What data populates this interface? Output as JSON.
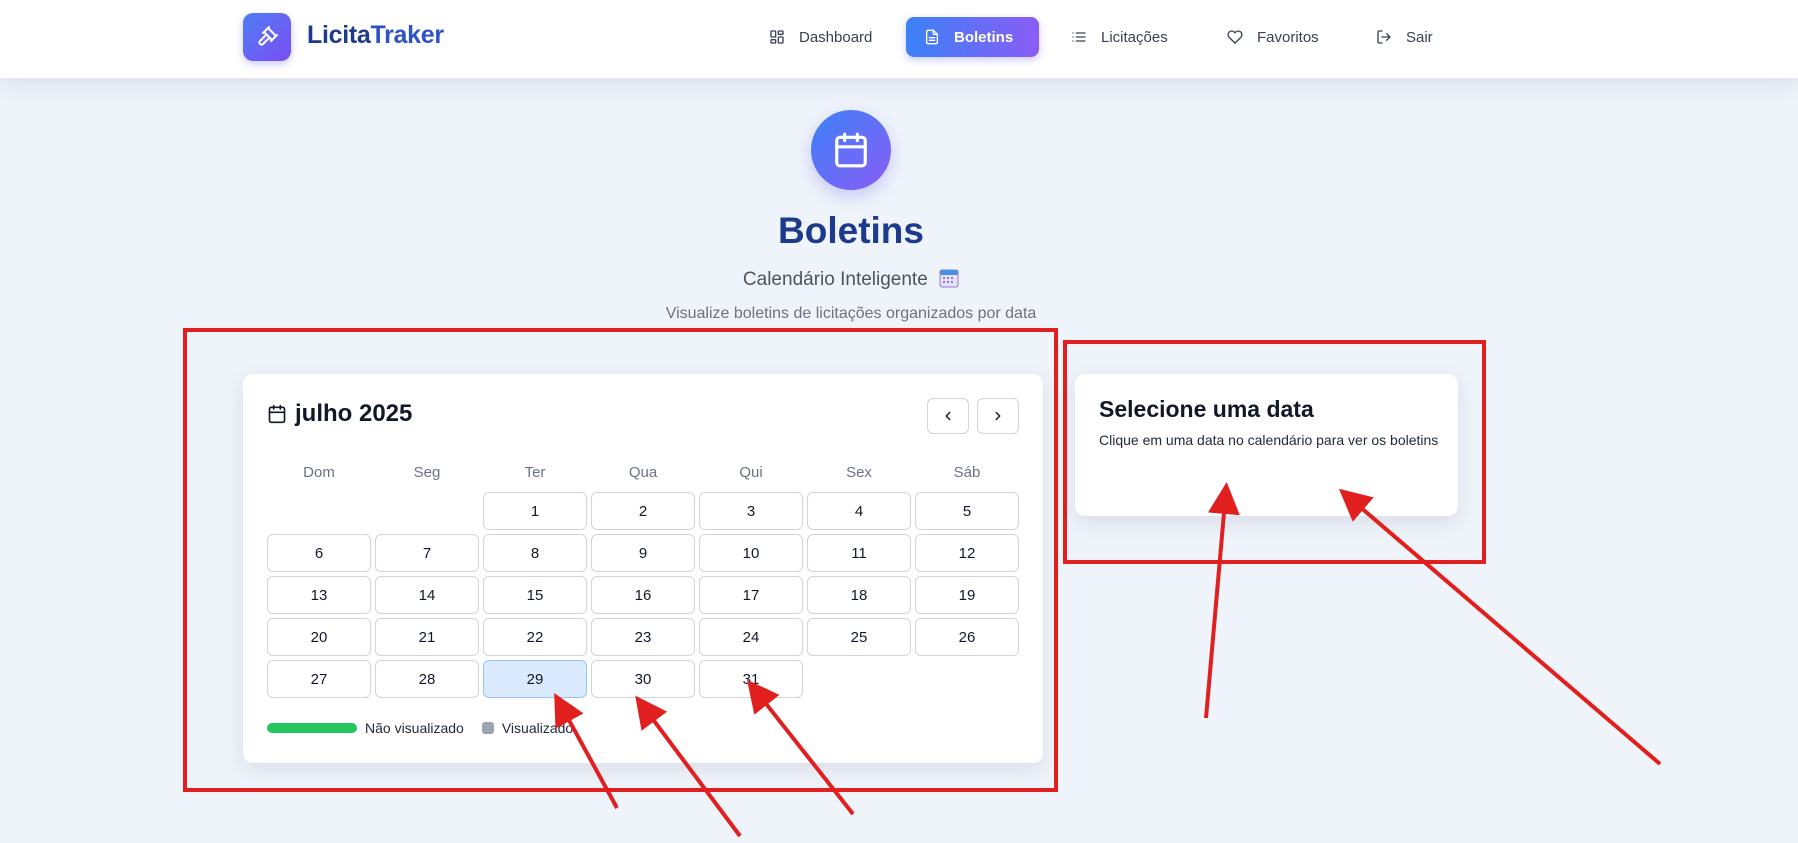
{
  "app": {
    "name_part1": "Licita",
    "name_part2": "Traker"
  },
  "nav": [
    {
      "label": "Dashboard",
      "icon": "dashboard-icon",
      "active": false
    },
    {
      "label": "Boletins",
      "icon": "document-icon",
      "active": true
    },
    {
      "label": "Licitações",
      "icon": "list-icon",
      "active": false
    },
    {
      "label": "Favoritos",
      "icon": "heart-icon",
      "active": false
    },
    {
      "label": "Sair",
      "icon": "logout-icon",
      "active": false
    }
  ],
  "hero": {
    "title": "Boletins",
    "subtitle": "Calendário Inteligente",
    "description": "Visualize boletins de licitações organizados por data"
  },
  "calendar": {
    "month_label": "julho 2025",
    "weekdays": [
      "Dom",
      "Seg",
      "Ter",
      "Qua",
      "Qui",
      "Sex",
      "Sáb"
    ],
    "first_weekday_index": 2,
    "days": [
      "1",
      "2",
      "3",
      "4",
      "5",
      "6",
      "7",
      "8",
      "9",
      "10",
      "11",
      "12",
      "13",
      "14",
      "15",
      "16",
      "17",
      "18",
      "19",
      "20",
      "21",
      "22",
      "23",
      "24",
      "25",
      "26",
      "27",
      "28",
      "29",
      "30",
      "31"
    ],
    "selected_day": "29",
    "legend": {
      "not_viewed": "Não visualizado",
      "viewed": "Visualizado"
    }
  },
  "side_panel": {
    "title": "Selecione uma data",
    "text": "Clique em uma data no calendário para ver os boletins"
  },
  "colors": {
    "brand": "#1e3a8a",
    "accent_start": "#3b82f6",
    "accent_end": "#8b5cf6",
    "not_viewed": "#22c55e",
    "viewed": "#9ca3af",
    "annotation": "#e21f1f"
  }
}
